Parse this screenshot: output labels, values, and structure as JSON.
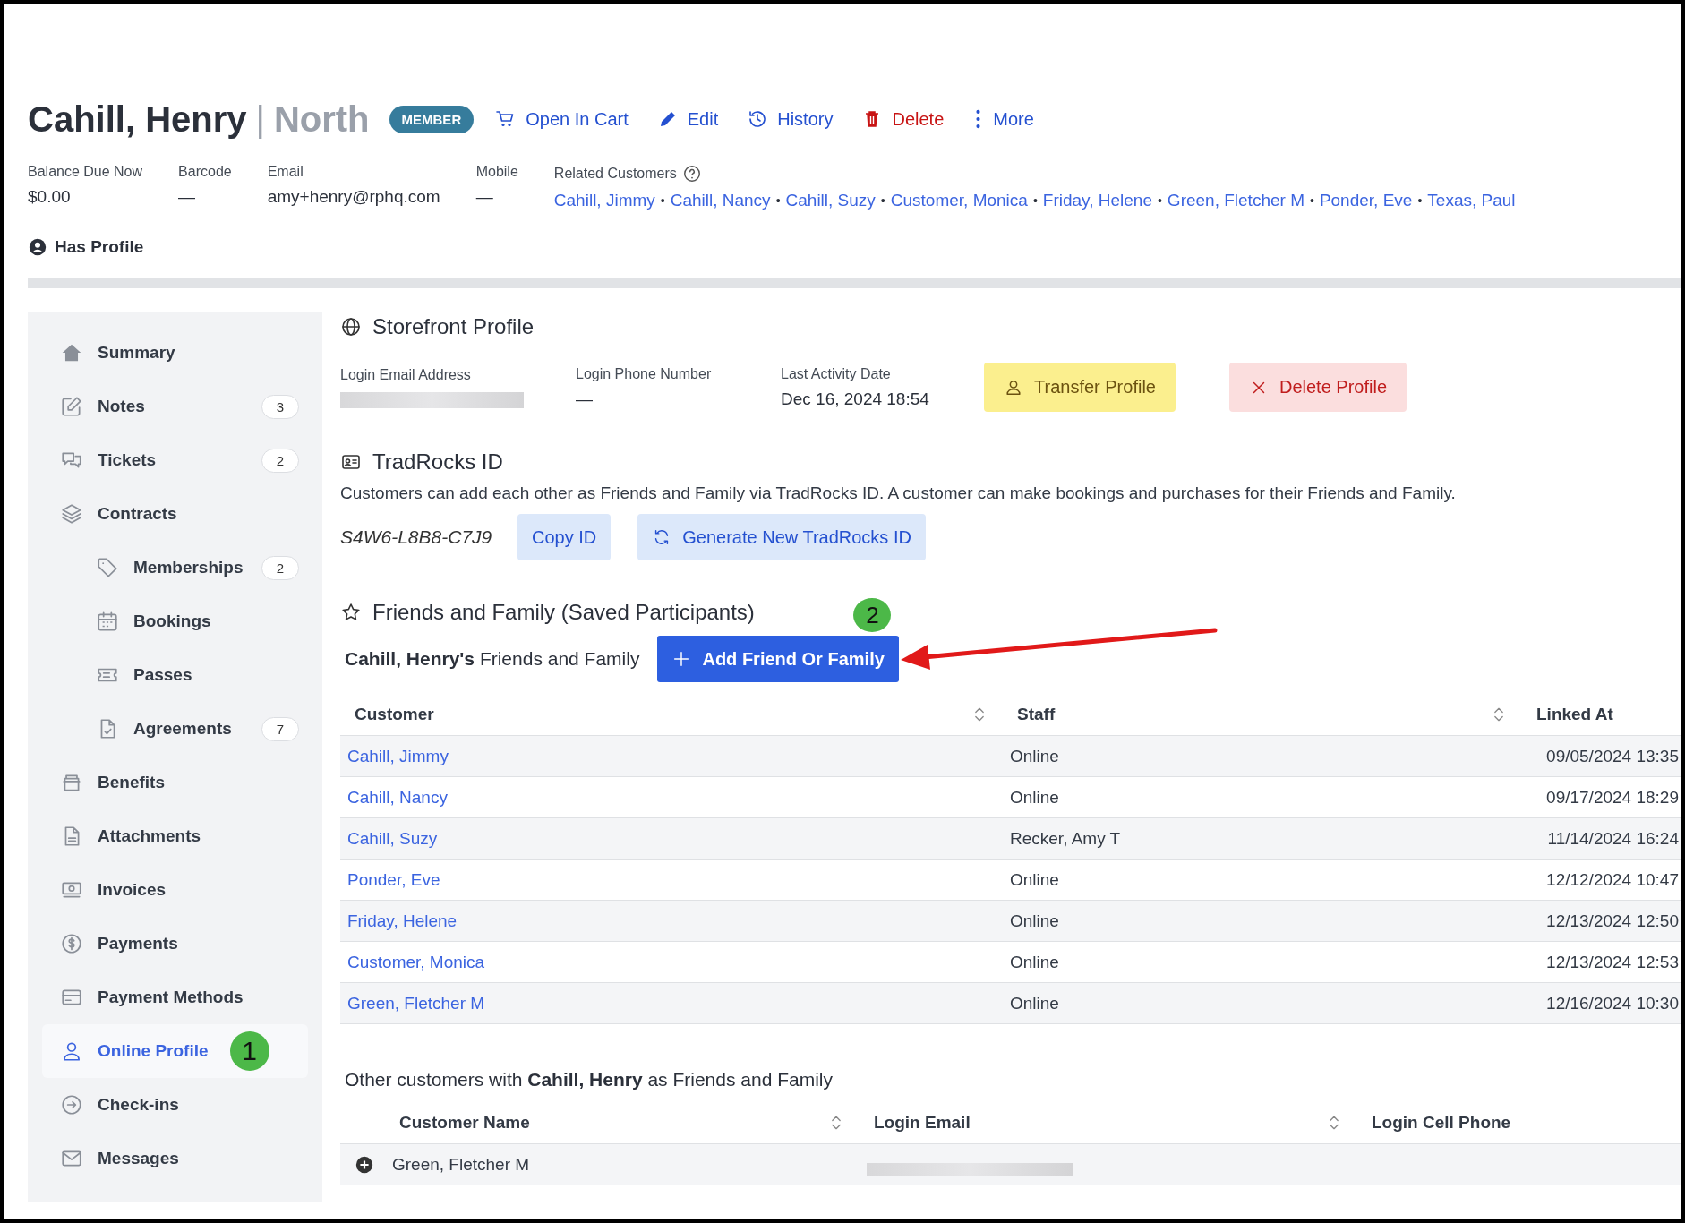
{
  "header": {
    "name": "Cahill, Henry",
    "separator": "|",
    "location": "North",
    "badge": "MEMBER",
    "actions": [
      {
        "label": "Open In Cart",
        "kind": "cart"
      },
      {
        "label": "Edit",
        "kind": "edit"
      },
      {
        "label": "History",
        "kind": "history"
      },
      {
        "label": "Delete",
        "kind": "delete"
      },
      {
        "label": "More",
        "kind": "more"
      }
    ]
  },
  "info": [
    {
      "label": "Balance Due Now",
      "value": "$0.00"
    },
    {
      "label": "Barcode",
      "value": "—"
    },
    {
      "label": "Email",
      "value": "amy+henry@rphq.com"
    },
    {
      "label": "Mobile",
      "value": "—"
    }
  ],
  "related": {
    "label": "Related Customers",
    "separator": "•",
    "links": [
      "Cahill, Jimmy",
      "Cahill, Nancy",
      "Cahill, Suzy",
      "Customer, Monica",
      "Friday, Helene",
      "Green, Fletcher M",
      "Ponder, Eve",
      "Texas, Paul"
    ]
  },
  "profile_status": "Has Profile",
  "sidebar": {
    "items": [
      {
        "label": "Summary",
        "selected": false
      },
      {
        "label": "Notes",
        "count": "3",
        "selected": false
      },
      {
        "label": "Tickets",
        "count": "2",
        "selected": false
      },
      {
        "label": "Contracts",
        "selected": false,
        "children": [
          {
            "label": "Memberships",
            "count": "2",
            "selected": false
          },
          {
            "label": "Bookings",
            "selected": false
          },
          {
            "label": "Passes",
            "selected": false
          },
          {
            "label": "Agreements",
            "count": "7",
            "selected": false
          }
        ]
      },
      {
        "label": "Benefits",
        "selected": false
      },
      {
        "label": "Attachments",
        "selected": false
      },
      {
        "label": "Invoices",
        "selected": false
      },
      {
        "label": "Payments",
        "selected": false
      },
      {
        "label": "Payment Methods",
        "selected": false
      },
      {
        "label": "Online Profile",
        "selected": true,
        "marker": "1"
      },
      {
        "label": "Check-ins",
        "selected": false
      },
      {
        "label": "Messages",
        "selected": false
      }
    ]
  },
  "storefront": {
    "title": "Storefront Profile",
    "fields": [
      {
        "label": "Login Email Address",
        "kind": "redacted"
      },
      {
        "label": "Login Phone Number",
        "kind": "text",
        "value": "—"
      },
      {
        "label": "Last Activity Date",
        "kind": "text",
        "value": "Dec 16, 2024 18:54"
      }
    ],
    "buttons": [
      {
        "label": "Transfer Profile",
        "kind": "transfer"
      },
      {
        "label": "Delete Profile",
        "kind": "delete"
      }
    ]
  },
  "tradrocks": {
    "title": "TradRocks ID",
    "description": "Customers can add each other as Friends and Family via TradRocks ID. A customer can make bookings and purchases for their Friends and Family.",
    "id": "S4W6-L8B8-C7J9",
    "buttons": [
      {
        "label": "Copy ID",
        "kind": "copy"
      },
      {
        "label": "Generate New TradRocks ID",
        "kind": "generate"
      }
    ]
  },
  "friends": {
    "title": "Friends and Family (Saved Participants)",
    "subtitle": "**Cahill, Henry's** Friends and Family",
    "add_button": "Add Friend Or Family",
    "marker": "2",
    "table": {
      "columns": [
        {
          "label": "Customer",
          "sortable": true
        },
        {
          "label": "Staff",
          "sortable": true
        },
        {
          "label": "Linked At",
          "sortable": false
        }
      ],
      "rows": [
        {
          "customer": "Cahill, Jimmy",
          "staff": "Online",
          "linked_at": "09/05/2024 13:35"
        },
        {
          "customer": "Cahill, Nancy",
          "staff": "Online",
          "linked_at": "09/17/2024 18:29"
        },
        {
          "customer": "Cahill, Suzy",
          "staff": "Recker, Amy T",
          "linked_at": "11/14/2024 16:24"
        },
        {
          "customer": "Ponder, Eve",
          "staff": "Online",
          "linked_at": "12/12/2024 10:47"
        },
        {
          "customer": "Friday, Helene",
          "staff": "Online",
          "linked_at": "12/13/2024 12:50"
        },
        {
          "customer": "Customer, Monica",
          "staff": "Online",
          "linked_at": "12/13/2024 12:53"
        },
        {
          "customer": "Green, Fletcher M",
          "staff": "Online",
          "linked_at": "12/16/2024 10:30"
        }
      ]
    }
  },
  "others": {
    "title": "Other customers with **Cahill, Henry** as Friends and Family",
    "table": {
      "columns": [
        {
          "label": "Customer Name",
          "sortable": true
        },
        {
          "label": "Login Email",
          "sortable": true
        },
        {
          "label": "Login Cell Phone",
          "sortable": false
        }
      ],
      "rows": [
        {
          "customer_name": "Green, Fletcher M",
          "email_redacted": true,
          "expanded": false
        }
      ]
    }
  }
}
